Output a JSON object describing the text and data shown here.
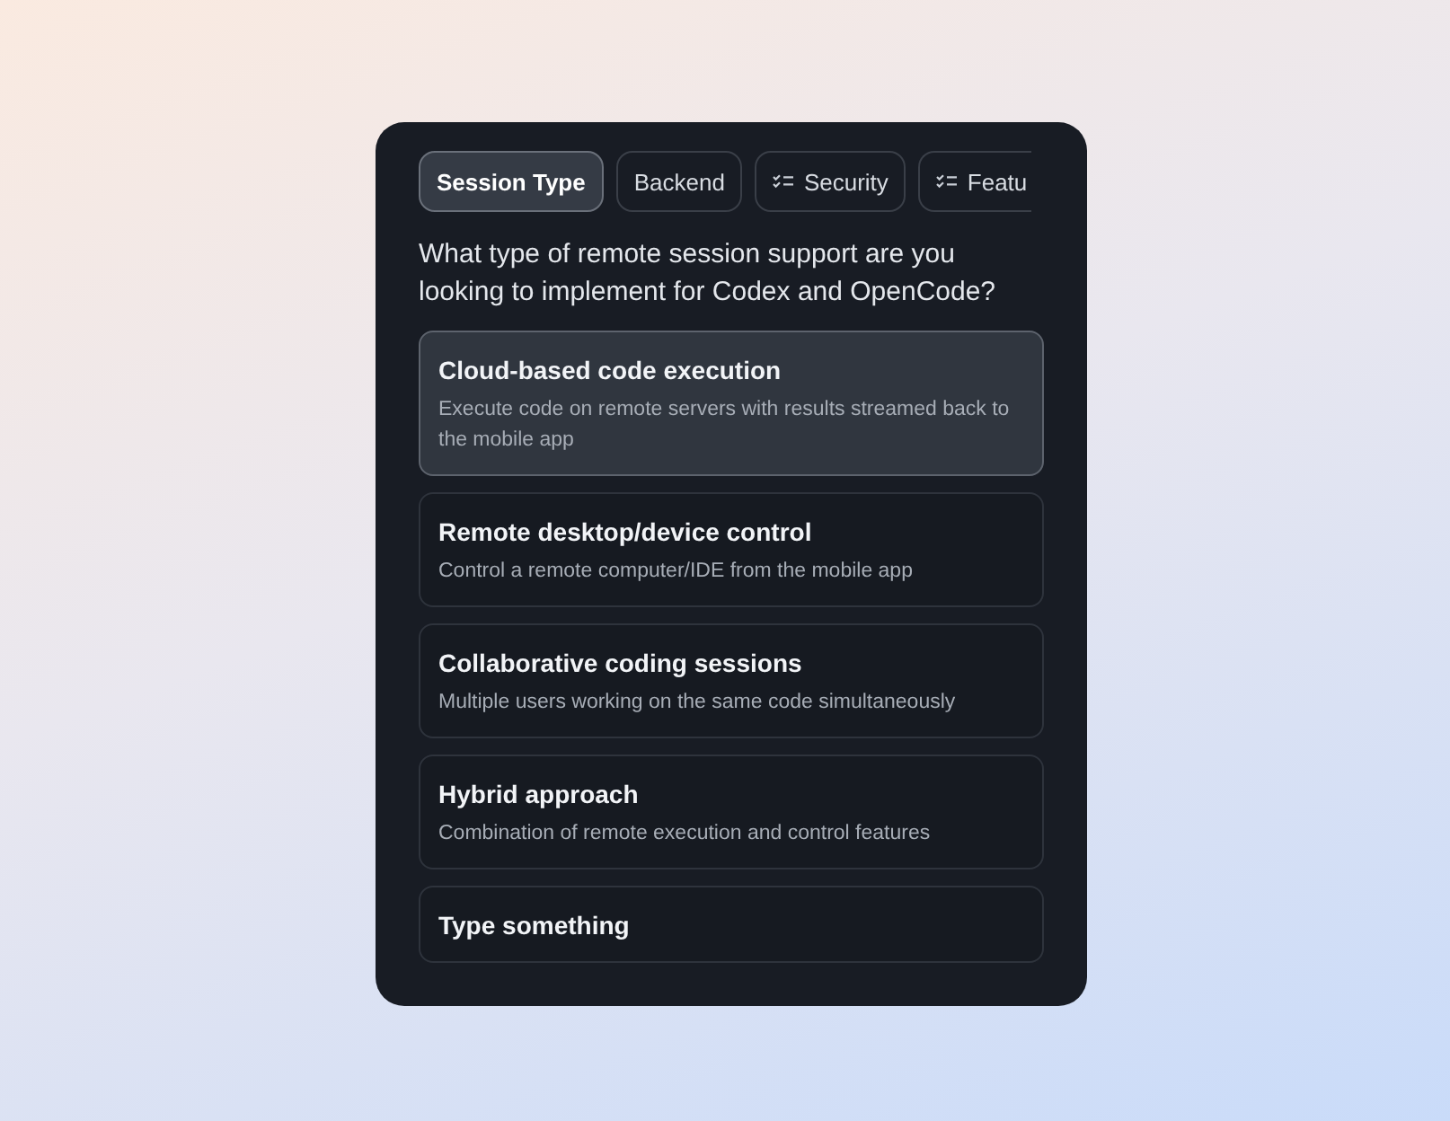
{
  "tabs": [
    {
      "label": "Session Type",
      "kind": "plain",
      "selected": true
    },
    {
      "label": "Backend",
      "kind": "plain",
      "selected": false
    },
    {
      "label": "Security",
      "kind": "checklist",
      "selected": false
    },
    {
      "label": "Featu",
      "kind": "checklist",
      "selected": false
    }
  ],
  "question": "What type of remote session support are you looking to implement for Codex and OpenCode?",
  "options": [
    {
      "title": "Cloud-based code execution",
      "description": "Execute code on remote servers with results streamed back to the mobile app",
      "selected": true
    },
    {
      "title": "Remote desktop/device control",
      "description": "Control a remote computer/IDE from the mobile app",
      "selected": false
    },
    {
      "title": "Collaborative coding sessions",
      "description": "Multiple users working on the same code simultaneously",
      "selected": false
    },
    {
      "title": "Hybrid approach",
      "description": "Combination of remote execution and control features",
      "selected": false
    },
    {
      "title": "Type something",
      "selected": false
    }
  ]
}
